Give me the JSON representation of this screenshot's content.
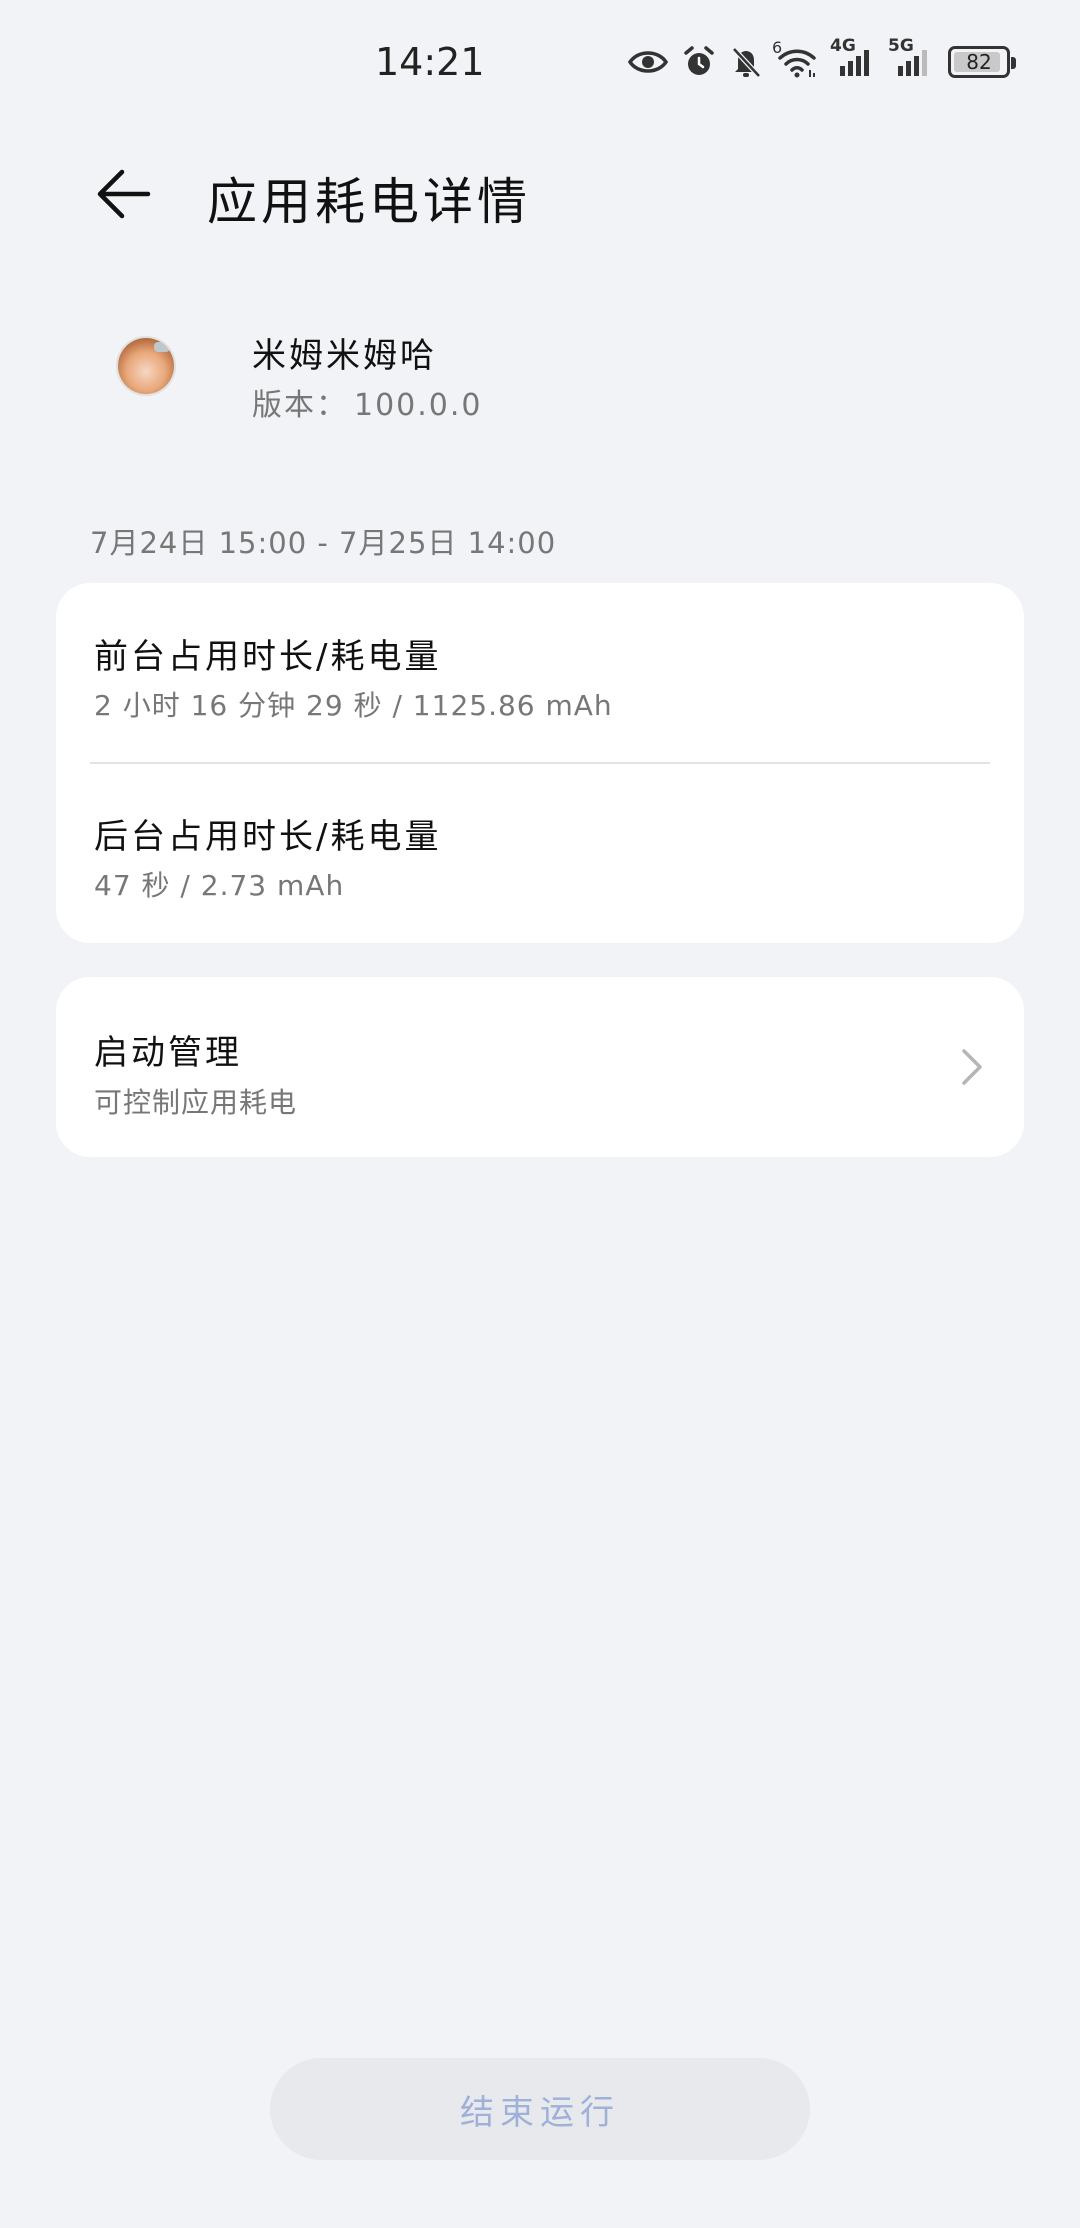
{
  "status_bar": {
    "time": "14:21",
    "wifi_badge": "6",
    "net1_label": "4G",
    "net2_label": "5G",
    "battery_percent": "82",
    "icons": [
      "eye-icon",
      "alarm-icon",
      "bell-muted-icon",
      "wifi-icon",
      "signal-4g-icon",
      "signal-5g-icon",
      "battery-icon"
    ]
  },
  "header": {
    "title": "应用耗电详情",
    "back_icon": "arrow-left-icon"
  },
  "app": {
    "name": "米姆米姆哈",
    "version_label": "版本：",
    "version_value": "100.0.0"
  },
  "date_range": "7月24日 15:00 - 7月25日 14:00",
  "usage": {
    "foreground": {
      "title": "前台占用时长/耗电量",
      "value": "2 小时 16 分钟 29 秒 / 1125.86 mAh"
    },
    "background": {
      "title": "后台占用时长/耗电量",
      "value": "47 秒 / 2.73 mAh"
    }
  },
  "launch_management": {
    "title": "启动管理",
    "subtitle": "可控制应用耗电",
    "icon": "chevron-right-icon"
  },
  "end_button": {
    "label": "结束运行"
  },
  "colors": {
    "background": "#f1f3f6",
    "card": "#ffffff",
    "end_button_bg": "#e8e9ed",
    "end_button_text": "#9fb1d8"
  }
}
